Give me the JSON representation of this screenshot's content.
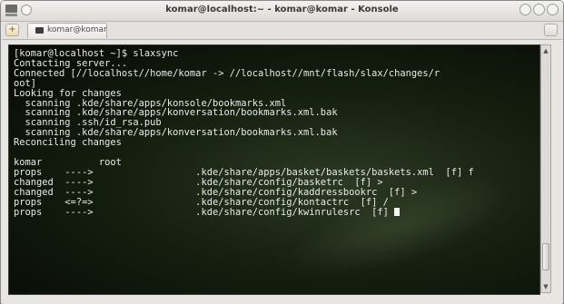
{
  "window": {
    "title": "komar@localhost:~ - komar@komar - Konsole",
    "tab_label": "komar@komar"
  },
  "terminal": {
    "lines": [
      "[komar@localhost ~]$ slaxsync",
      "Contacting server...",
      "Connected [//localhost//home/komar -> //localhost//mnt/flash/slax/changes/r",
      "oot]",
      "Looking for changes",
      "  scanning .kde/share/apps/konsole/bookmarks.xml",
      "  scanning .kde/share/apps/konversation/bookmarks.xml.bak",
      "  scanning .ssh/id_rsa.pub",
      "  scanning .kde/share/apps/konversation/bookmarks.xml.bak",
      "Reconciling changes",
      "",
      "komar          root",
      "props    ---->                  .kde/share/apps/basket/baskets/baskets.xml  [f] f",
      "changed  ---->                  .kde/share/config/basketrc  [f] >",
      "changed  ---->                  .kde/share/config/kaddressbookrc  [f] >",
      "props    <=?=>                  .kde/share/config/kontactrc  [f] /",
      "props    ---->                  .kde/share/config/kwinrulesrc  [f] "
    ]
  },
  "icons": {
    "window_menu": "konsole-window-icon",
    "sticky": "sticky-pin-icon",
    "minimize": "minimize-icon",
    "maximize": "maximize-icon",
    "close": "close-icon",
    "new_tab": "new-tab-icon",
    "tab_icon": "terminal-icon",
    "close_tab": "close-tab-icon",
    "scroll_up": "arrow-up-icon",
    "scroll_down": "arrow-down-icon"
  },
  "colors": {
    "terminal_text": "#e9e9e9",
    "terminal_background": "#15200f"
  }
}
